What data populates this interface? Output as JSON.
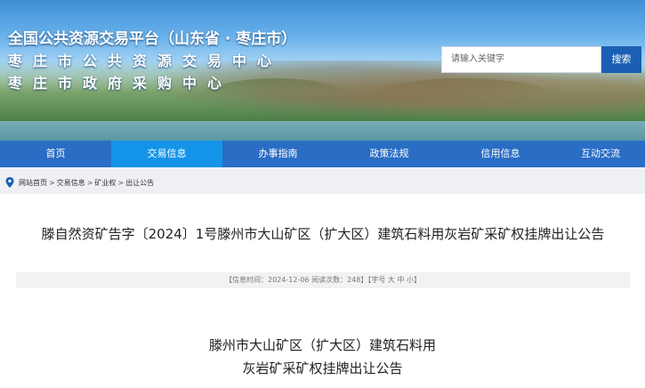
{
  "banner": {
    "line1": "全国公共资源交易平台（山东省 · 枣庄市）",
    "line2": "枣庄市公共资源交易中心",
    "line3": "枣庄市政府采购中心"
  },
  "search": {
    "placeholder": "请输入关键字",
    "button_label": "搜索"
  },
  "nav": {
    "items": [
      {
        "label": "首页"
      },
      {
        "label": "交易信息"
      },
      {
        "label": "办事指南"
      },
      {
        "label": "政策法规"
      },
      {
        "label": "信用信息"
      },
      {
        "label": "互动交流"
      }
    ],
    "active_index": 1
  },
  "breadcrumb": {
    "items": [
      "网站首页",
      "交易信息",
      "矿业权",
      "出让公告"
    ],
    "separator": ">"
  },
  "article": {
    "title": "滕自然资矿告字〔2024〕1号滕州市大山矿区（扩大区）建筑石料用灰岩矿采矿权挂牌出让公告",
    "meta": "【信息时间：2024-12-06   阅读次数：248】【字号 大 中 小】",
    "subtitle_line1": "滕州市大山矿区（扩大区）建筑石料用",
    "subtitle_line2": "灰岩矿采矿权挂牌出让公告"
  },
  "colors": {
    "nav_bg": "#2a6dc4",
    "nav_active": "#1494e8",
    "search_button": "#1a5fb4"
  }
}
